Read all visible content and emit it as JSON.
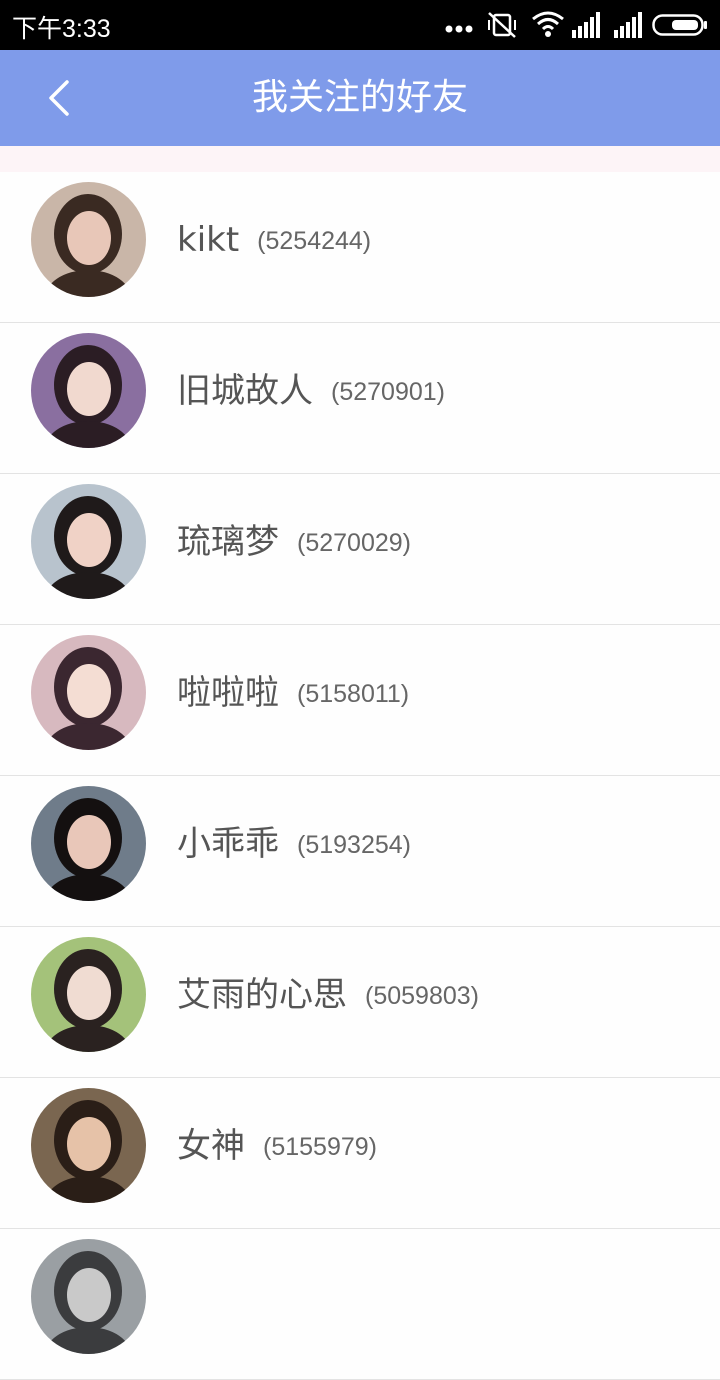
{
  "status_bar": {
    "time": "下午3:33",
    "icons": [
      "more-dots-icon",
      "vibrate-off-icon",
      "wifi-icon",
      "signal-icon",
      "signal-icon",
      "battery-icon"
    ]
  },
  "header": {
    "title": "我关注的好友",
    "back_icon": "chevron-left-icon"
  },
  "friends": [
    {
      "name": "kikt",
      "id": "(5254244)",
      "avatar_colors": [
        "#c9b6a8",
        "#3a2a22",
        "#e8c7b8"
      ]
    },
    {
      "name": "旧城故人",
      "id": "(5270901)",
      "avatar_colors": [
        "#8a6fa0",
        "#2b1d24",
        "#f1d9cf"
      ]
    },
    {
      "name": "琉璃梦",
      "id": "(5270029)",
      "avatar_colors": [
        "#b8c3cd",
        "#1f1a1a",
        "#f0d2c6"
      ]
    },
    {
      "name": "啦啦啦",
      "id": "(5158011)",
      "avatar_colors": [
        "#d7b9bf",
        "#3b2730",
        "#f4ddd3"
      ]
    },
    {
      "name": "小乖乖",
      "id": "(5193254)",
      "avatar_colors": [
        "#6f7c8a",
        "#141010",
        "#e9c7b9"
      ]
    },
    {
      "name": "艾雨的心思",
      "id": "(5059803)",
      "avatar_colors": [
        "#a4c27a",
        "#2a2220",
        "#f0dcd2"
      ]
    },
    {
      "name": "女神",
      "id": "(5155979)",
      "avatar_colors": [
        "#7a6650",
        "#2a1e17",
        "#e6c2a8"
      ]
    },
    {
      "name": "",
      "id": "",
      "avatar_colors": [
        "#9a9fa3",
        "#3b3c3e",
        "#c9c9c9"
      ]
    }
  ]
}
